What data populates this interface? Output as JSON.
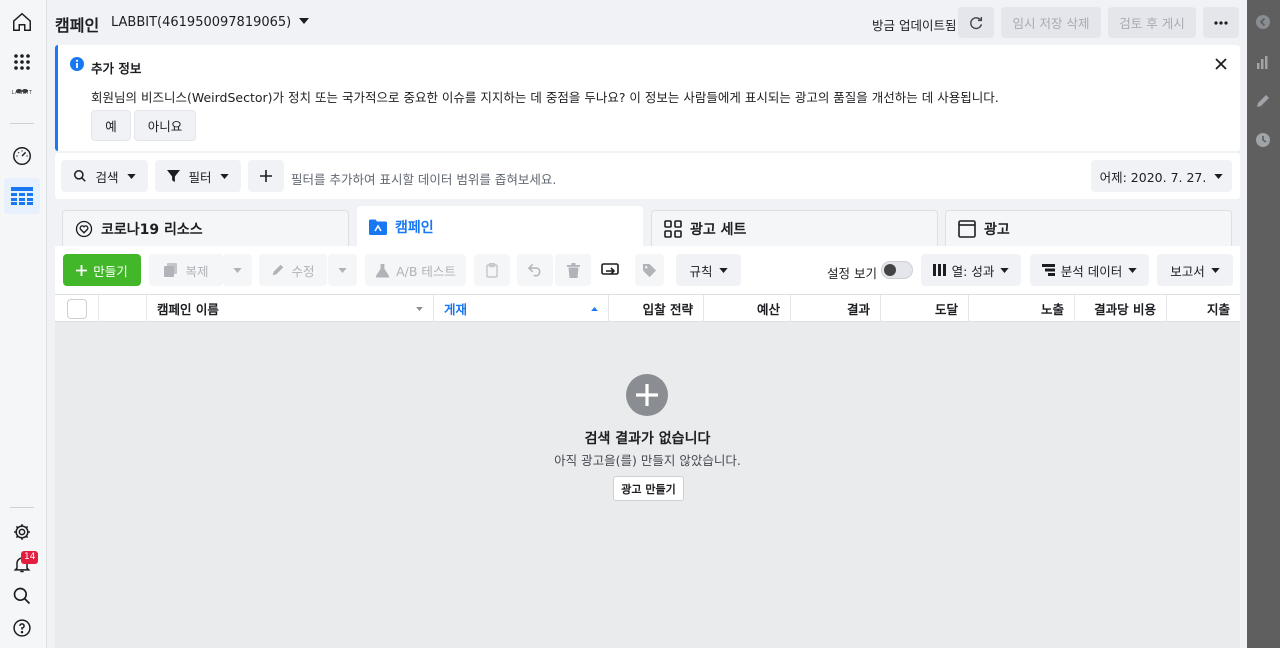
{
  "left_nav": {
    "logo_text": "LABBIT",
    "notification_count": "14",
    "icons": [
      "home-icon",
      "apps-grid-icon",
      "account-logo",
      "dashboard-gauge-icon",
      "ads-manager-table-icon",
      "settings-gear-icon",
      "bell-icon",
      "search-icon",
      "help-icon"
    ]
  },
  "header": {
    "title": "캠페인",
    "account": "LABBIT(461950097819065)",
    "update_status": "방금 업데이트됨",
    "discard_draft": "임시 저장 삭제",
    "review_publish": "검토 후 게시"
  },
  "banner": {
    "title": "추가 정보",
    "text": "회원님의 비즈니스(WeirdSector)가 정치 또는 국가적으로 중요한 이슈를 지지하는 데 중점을 두나요? 이 정보는 사람들에게 표시되는 광고의 품질을 개선하는 데 사용됩니다.",
    "yes": "예",
    "no": "아니요"
  },
  "filter_bar": {
    "search": "검색",
    "filter": "필터",
    "placeholder": "필터를 추가하여 표시할 데이터 범위를 좁혀보세요.",
    "date": "어제: 2020. 7. 27."
  },
  "tabs": [
    {
      "label": "코로나19 리소스"
    },
    {
      "label": "캠페인"
    },
    {
      "label": "광고 세트"
    },
    {
      "label": "광고"
    }
  ],
  "toolbar": {
    "create": "만들기",
    "duplicate": "복제",
    "edit": "수정",
    "ab_test": "A/B 테스트",
    "rules": "규칙",
    "setting_view": "설정 보기",
    "columns": "열: 성과",
    "breakdown": "분석 데이터",
    "reports": "보고서"
  },
  "table": {
    "columns": [
      "캠페인 이름",
      "게재",
      "입찰 전략",
      "예산",
      "결과",
      "도달",
      "노출",
      "결과당 비용",
      "지출"
    ]
  },
  "empty_state": {
    "title": "검색 결과가 없습니다",
    "subtitle": "아직 광고을(를) 만들지 않았습니다.",
    "button": "광고 만들기"
  },
  "colors": {
    "accent": "#1877f2",
    "create_green": "#42b72a",
    "badge_red": "#e41e3f"
  }
}
